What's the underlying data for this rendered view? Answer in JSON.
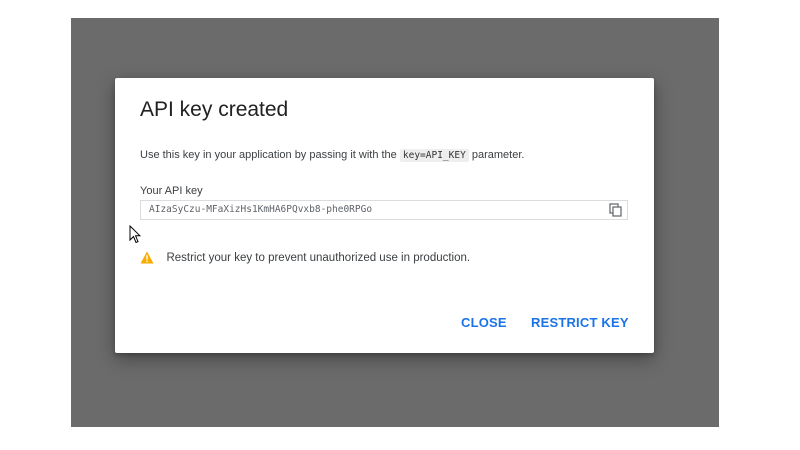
{
  "dialog": {
    "title": "API key created",
    "description_prefix": "Use this key in your application by passing it with the",
    "description_code": "key=API_KEY",
    "description_suffix": "parameter.",
    "key_label": "Your API key",
    "key_value": "AIzaSyCzu-MFaXizHs1KmHA6PQvxb8-phe0RPGo",
    "warning_text": "Restrict your key to prevent unauthorized use in production.",
    "close_label": "CLOSE",
    "restrict_label": "RESTRICT KEY"
  },
  "icons": {
    "copy": "copy-icon",
    "warning": "warning-icon",
    "cursor": "mouse-pointer-icon"
  },
  "colors": {
    "accent": "#1a73e8",
    "warning": "#f9ab00",
    "backdrop": "#6b6b6b"
  }
}
